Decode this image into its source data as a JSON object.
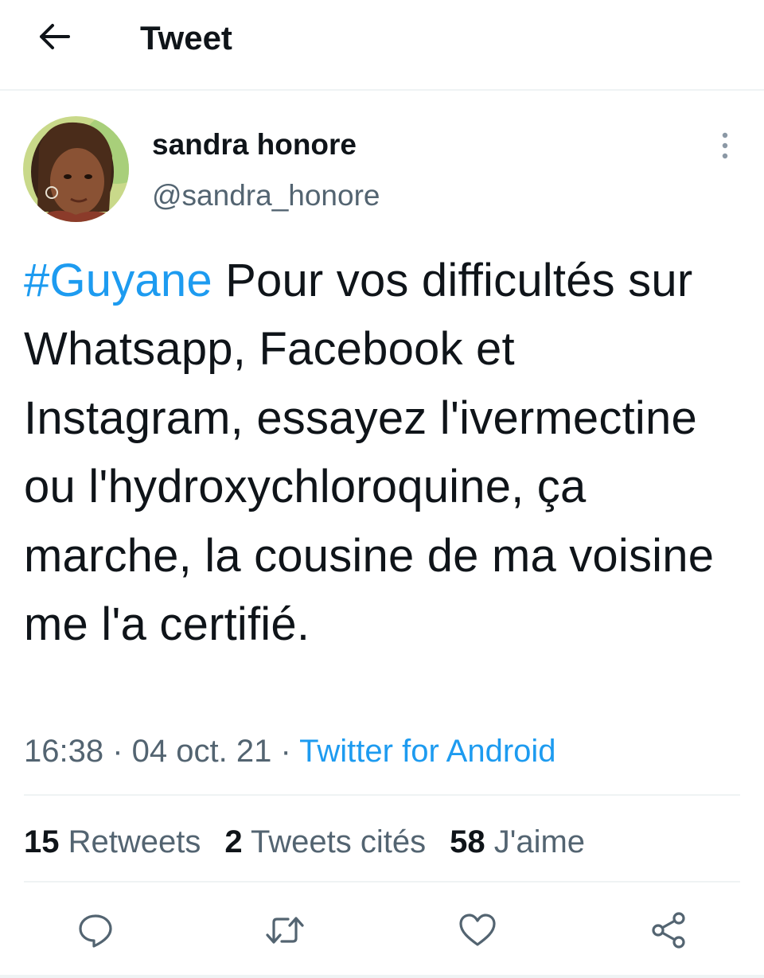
{
  "header": {
    "title": "Tweet",
    "back_icon": "arrow-left-icon"
  },
  "author": {
    "display_name": "sandra honore",
    "handle": "@sandra_honore",
    "avatar": "profile-photo"
  },
  "tweet": {
    "hashtag": "#Guyane",
    "text": " Pour vos difficultés sur Whatsapp, Facebook et Instagram, essayez l'ivermectine ou l'hydroxychloroquine, ça marche, la cousine de ma voisine me l'a certifié."
  },
  "meta": {
    "time": "16:38",
    "date": "04 oct. 21",
    "separator": " · ",
    "source": "Twitter for Android"
  },
  "stats": {
    "retweets_count": "15",
    "retweets_label": "Retweets",
    "quotes_count": "2",
    "quotes_label": "Tweets cités",
    "likes_count": "58",
    "likes_label": "J'aime"
  },
  "actions": [
    "reply-icon",
    "retweet-icon",
    "like-icon",
    "share-icon"
  ],
  "colors": {
    "text": "#0f1419",
    "secondary": "#536471",
    "accent": "#1d9bf0",
    "divider": "#eff3f4"
  }
}
